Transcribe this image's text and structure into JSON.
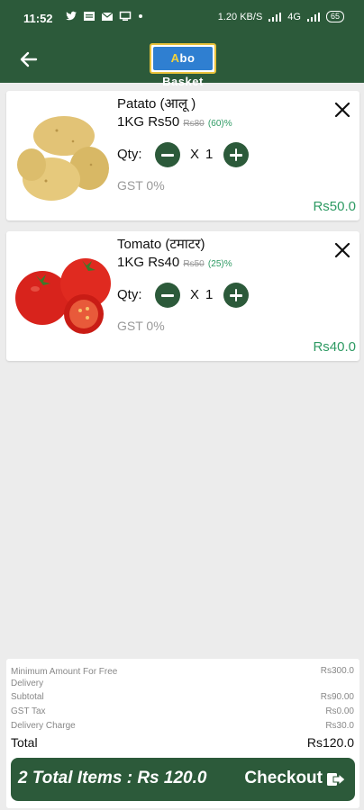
{
  "status_bar": {
    "time": "11:52",
    "left_icons": [
      "twitter-icon",
      "message-icon",
      "mail-icon",
      "screen-icon",
      "dot-icon"
    ],
    "network": "1.20 KB/S",
    "signal": "4G",
    "battery": "65"
  },
  "app_bar": {
    "logo_prefix": "A",
    "logo_text": "bo Basket"
  },
  "cart": {
    "items": [
      {
        "name": "Patato (आलू )",
        "unit": "1KG",
        "price": "Rs50",
        "mrp": "Rs80",
        "discount": "(60)%",
        "qty_label": "Qty:",
        "qty_x": "X",
        "qty": "1",
        "gst": "GST 0%",
        "total": "Rs50.0"
      },
      {
        "name": "Tomato (टमाटर)",
        "unit": "1KG",
        "price": "Rs40",
        "mrp": "Rs50",
        "discount": "(25)%",
        "qty_label": "Qty:",
        "qty_x": "X",
        "qty": "1",
        "gst": "GST 0%",
        "total": "Rs40.0"
      }
    ]
  },
  "summary": {
    "min_label": "Minimum Amount For Free Delivery",
    "min_value": "Rs300.0",
    "subtotal_label": "Subtotal",
    "subtotal_value": "Rs90.00",
    "gst_label": "GST Tax",
    "gst_value": "Rs0.00",
    "delivery_label": "Delivery Charge",
    "delivery_value": "Rs30.0",
    "total_label": "Total",
    "total_value": "Rs120.0"
  },
  "checkout": {
    "items_text": "2 Total Items : Rs 120.0",
    "cta_label": "Checkout"
  },
  "colors": {
    "primary": "#2c5a3a",
    "accent_green": "#2e9a63",
    "background": "#ececec"
  }
}
